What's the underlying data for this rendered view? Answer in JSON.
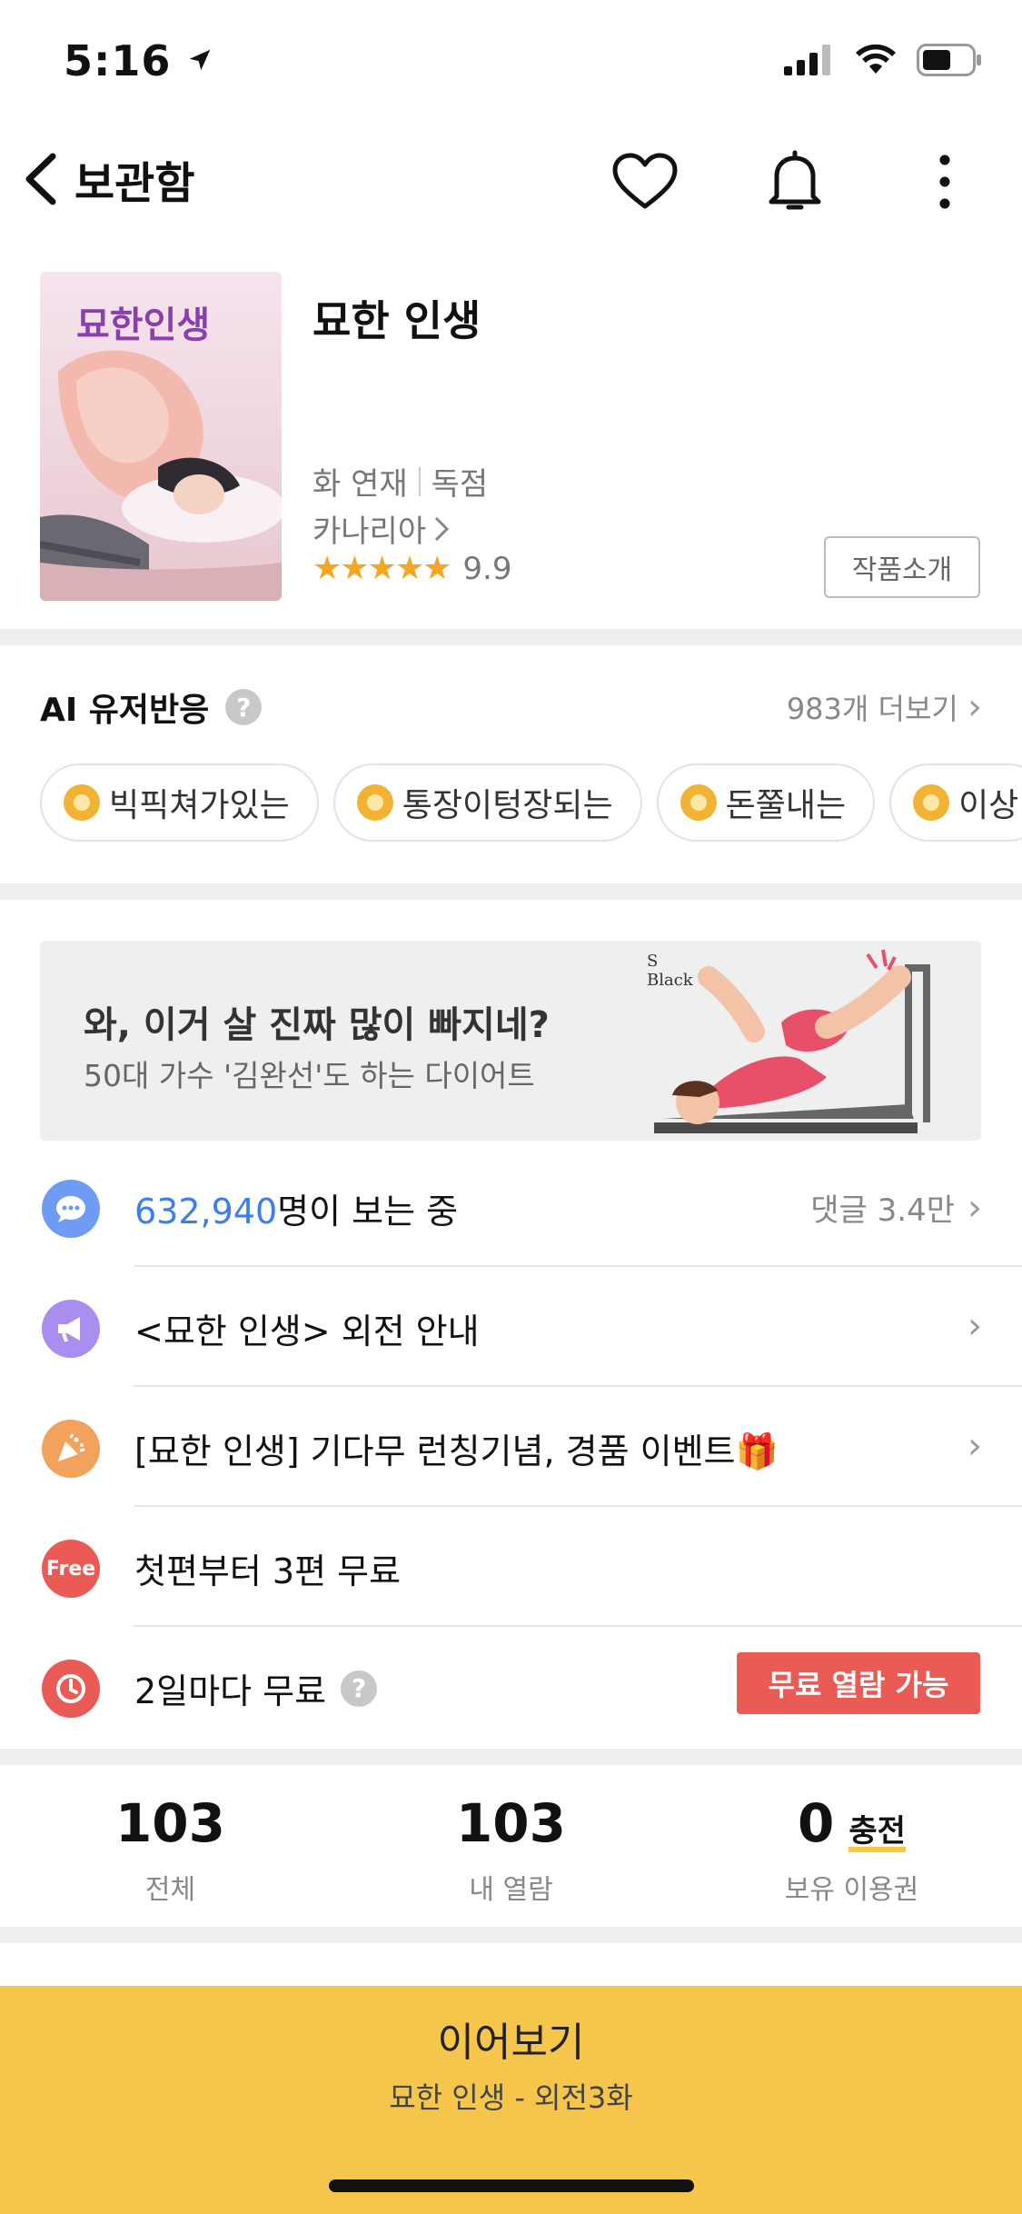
{
  "status_bar": {
    "time": "5:16"
  },
  "nav": {
    "back_label": "보관함"
  },
  "series": {
    "title": "묘한 인생",
    "cover_title": "묘한인생",
    "serial": "화 연재",
    "exclusive": "독점",
    "author": "카나리아",
    "stars": "★★★★★",
    "rating": "9.9",
    "intro_button": "작품소개"
  },
  "ai_reactions": {
    "title": "AI 유저반응",
    "help": "?",
    "more": "983개 더보기",
    "chips": [
      "빅픽쳐가있는",
      "통장이텅장되는",
      "돈쭐내는",
      "이상"
    ]
  },
  "ad": {
    "headline": "와, 이거 살 진짜 많이 빠지네?",
    "sub": "50대 가수 '김완선'도 하는 다이어트",
    "brand": "S Black"
  },
  "info": {
    "viewers_count": "632,940",
    "viewers_suffix": "명이 보는 중",
    "comments": "댓글 3.4만",
    "notice": "<묘한 인생> 외전 안내",
    "event": "[묘한 인생] 기다무 런칭기념, 경품 이벤트🎁",
    "free_badge": "Free",
    "free_first": "첫편부터 3편 무료",
    "wait_free": "2일마다 무료",
    "wait_help": "?",
    "wait_free_button": "무료 열람 가능",
    "chevron": "›"
  },
  "stats": [
    {
      "value": "103",
      "label": "전체"
    },
    {
      "value": "103",
      "label": "내 열람"
    },
    {
      "value": "0",
      "charge": "충전",
      "label": "보유 이용권"
    }
  ],
  "continue_bar": {
    "title": "이어보기",
    "subtitle": "묘한 인생 - 외전3화"
  },
  "colors": {
    "accent_blue": "#3a7ef0",
    "free_red": "#ea5b55",
    "continue_yellow": "#f5c64b",
    "star": "#f5a623"
  }
}
